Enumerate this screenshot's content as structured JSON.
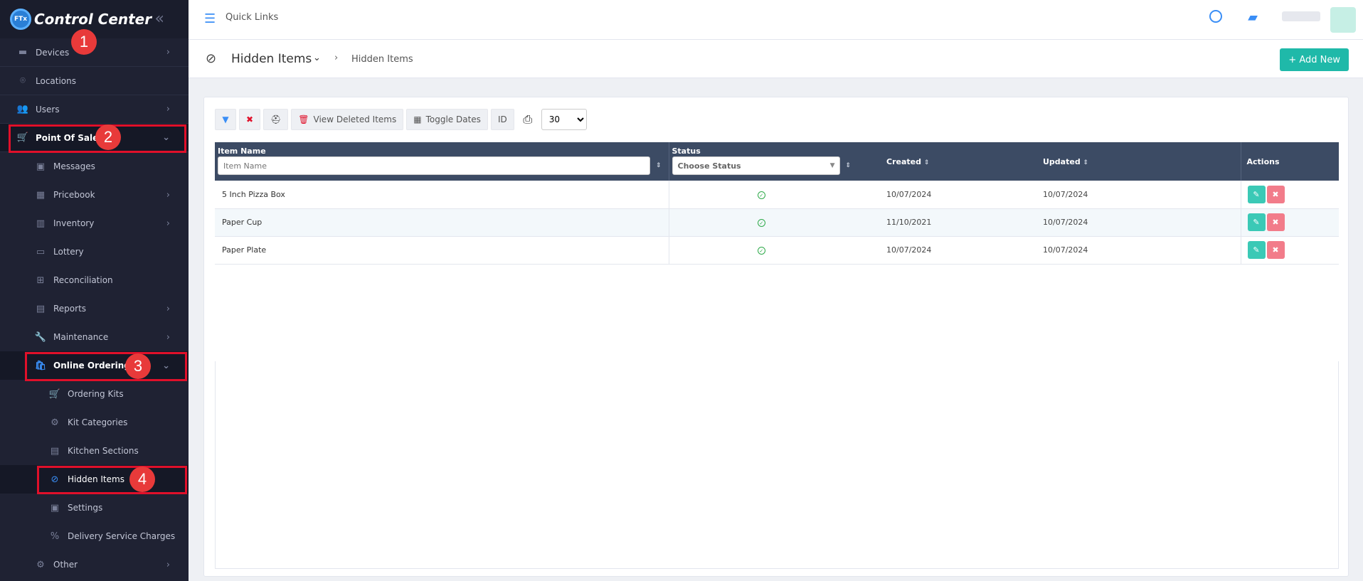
{
  "brand": {
    "logo_text": "FTx",
    "title": "Control Center"
  },
  "sidebar": {
    "items": [
      {
        "key": "devices",
        "label": "Devices"
      },
      {
        "key": "locations",
        "label": "Locations"
      },
      {
        "key": "users",
        "label": "Users"
      },
      {
        "key": "pos",
        "label": "Point Of Sale"
      },
      {
        "key": "messages",
        "label": "Messages"
      },
      {
        "key": "pricebook",
        "label": "Pricebook"
      },
      {
        "key": "inventory",
        "label": "Inventory"
      },
      {
        "key": "lottery",
        "label": "Lottery"
      },
      {
        "key": "reconciliation",
        "label": "Reconciliation"
      },
      {
        "key": "reports",
        "label": "Reports"
      },
      {
        "key": "maintenance",
        "label": "Maintenance"
      },
      {
        "key": "online_ordering",
        "label": "Online Ordering"
      },
      {
        "key": "ordering_kits",
        "label": "Ordering Kits"
      },
      {
        "key": "kit_categories",
        "label": "Kit Categories"
      },
      {
        "key": "kitchen_sections",
        "label": "Kitchen Sections"
      },
      {
        "key": "hidden_items",
        "label": "Hidden Items"
      },
      {
        "key": "settings",
        "label": "Settings"
      },
      {
        "key": "delivery",
        "label": "Delivery Service Charges"
      },
      {
        "key": "other",
        "label": "Other"
      }
    ]
  },
  "annotations": [
    "1",
    "2",
    "3",
    "4"
  ],
  "topbar": {
    "quick_links": "Quick Links"
  },
  "subheader": {
    "title": "Hidden Items",
    "breadcrumb": "Hidden Items",
    "add_new": "+ Add New"
  },
  "toolbar": {
    "view_deleted": "View Deleted Items",
    "toggle_dates": "Toggle Dates",
    "id": "ID",
    "page_size": "30"
  },
  "table": {
    "headers": {
      "item_name": "Item Name",
      "status": "Status",
      "created": "Created",
      "updated": "Updated",
      "actions": "Actions"
    },
    "item_name_placeholder": "Item Name",
    "status_placeholder": "Choose Status",
    "rows": [
      {
        "name": "5 Inch Pizza Box",
        "created": "10/07/2024",
        "updated": "10/07/2024"
      },
      {
        "name": "Paper Cup",
        "created": "11/10/2021",
        "updated": "10/07/2024"
      },
      {
        "name": "Paper Plate",
        "created": "10/07/2024",
        "updated": "10/07/2024"
      }
    ]
  },
  "colors": {
    "sidebar_bg": "#1f2233",
    "accent": "#1fb9a9",
    "header_bg": "#3c4b64",
    "highlight": "#e0102a",
    "badge": "#e83a3a"
  }
}
